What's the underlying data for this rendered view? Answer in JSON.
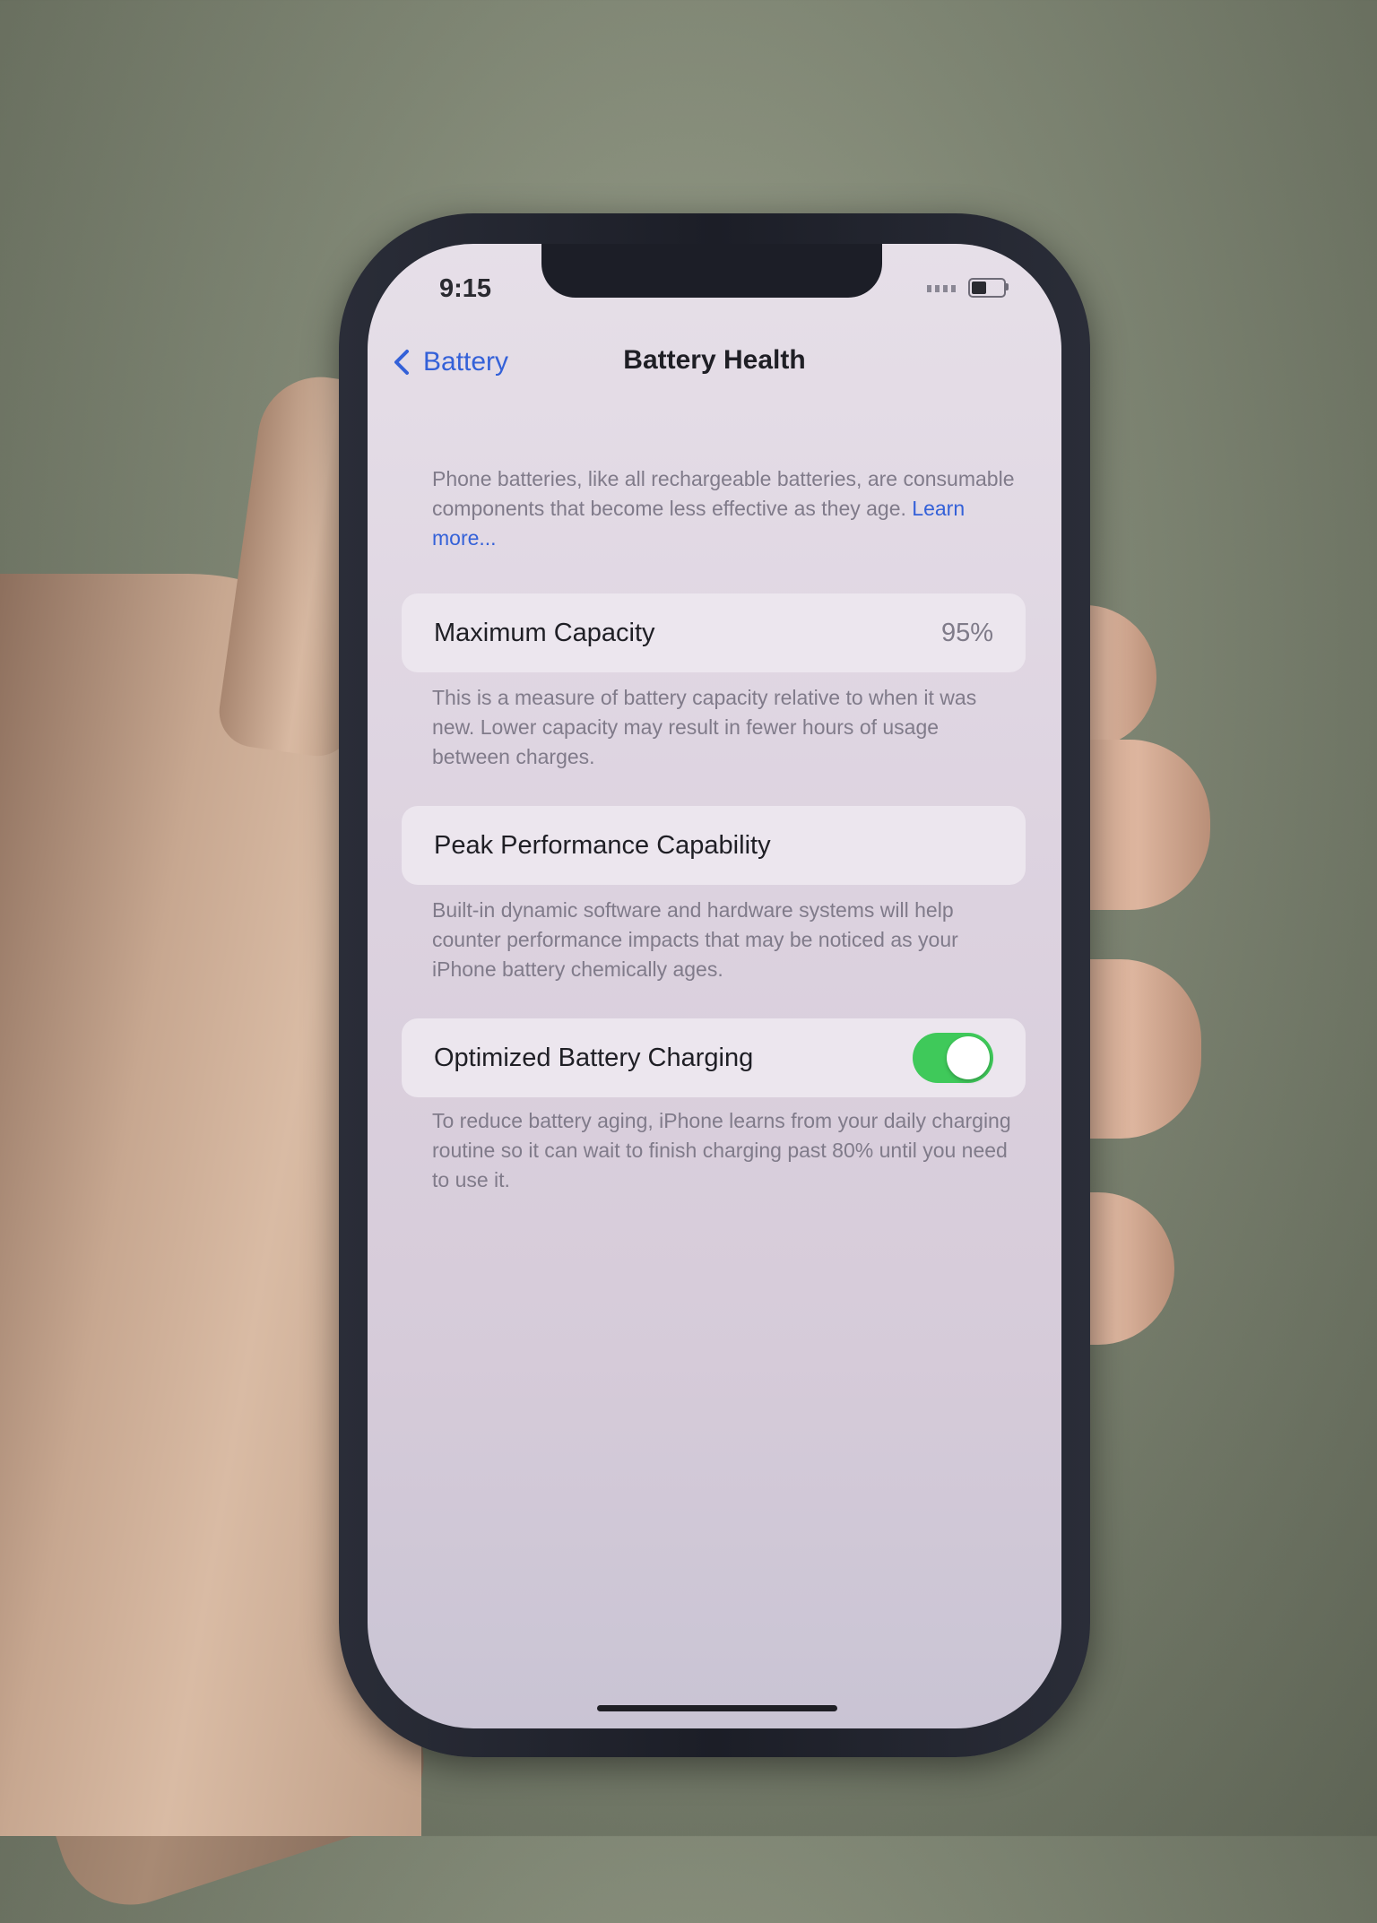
{
  "status_bar": {
    "time": "9:15"
  },
  "nav": {
    "back_label": "Battery",
    "title": "Battery Health"
  },
  "intro": {
    "text": "Phone batteries, like all rechargeable batteries, are consumable components that become less effective as they age.",
    "link": "Learn more..."
  },
  "maximum_capacity": {
    "label": "Maximum Capacity",
    "value": "95%",
    "footnote": "This is a measure of battery capacity relative to when it was new. Lower capacity may result in fewer hours of usage between charges."
  },
  "peak_performance": {
    "label": "Peak Performance Capability",
    "footnote": "Built-in dynamic software and hardware systems will help counter performance impacts that may be noticed as your iPhone battery chemically ages."
  },
  "optimized_charging": {
    "label": "Optimized Battery Charging",
    "enabled": true,
    "footnote": "To reduce battery aging, iPhone learns from your daily charging routine so it can wait to finish charging past 80% until you need to use it."
  },
  "colors": {
    "accent_blue": "#3461d8",
    "toggle_green": "#3fc95a"
  }
}
